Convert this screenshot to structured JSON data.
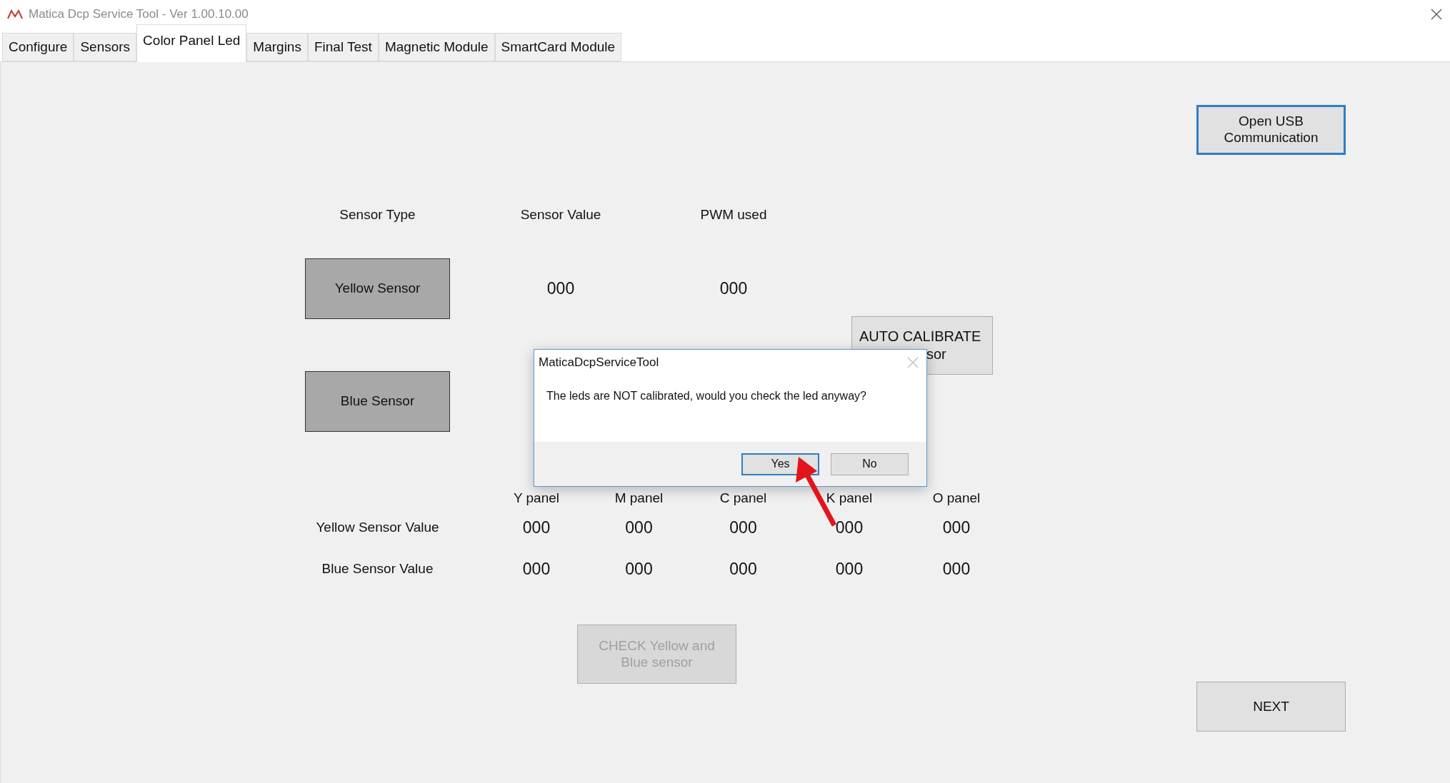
{
  "window": {
    "title": "Matica Dcp Service Tool - Ver 1.00.10.00"
  },
  "tabs": [
    {
      "label": "Configure",
      "selected": false
    },
    {
      "label": "Sensors",
      "selected": false
    },
    {
      "label": "Color Panel Led",
      "selected": true
    },
    {
      "label": "Margins",
      "selected": false
    },
    {
      "label": "Final Test",
      "selected": false
    },
    {
      "label": "Magnetic Module",
      "selected": false
    },
    {
      "label": "SmartCard Module",
      "selected": false
    }
  ],
  "usb_button": {
    "lines": [
      "Open USB",
      "Communication"
    ],
    "focused": true
  },
  "sensor_table": {
    "headers": [
      "Sensor Type",
      "Sensor Value",
      "PWM used"
    ],
    "rows": [
      {
        "sensor": "Yellow Sensor",
        "value": "000",
        "pwm": "000"
      },
      {
        "sensor": "Blue Sensor"
      }
    ]
  },
  "auto_calibrate": {
    "lines": [
      "AUTO CALIBRATE",
      "sor"
    ]
  },
  "panel_table": {
    "columns": [
      "Y panel",
      "M panel",
      "C panel",
      "K panel",
      "O panel"
    ],
    "rows": [
      {
        "label": "Yellow Sensor Value",
        "values": [
          "000",
          "000",
          "000",
          "000",
          "000"
        ]
      },
      {
        "label": "Blue Sensor Value",
        "values": [
          "000",
          "000",
          "000",
          "000",
          "000"
        ]
      }
    ]
  },
  "check_button": {
    "lines": [
      "CHECK Yellow and",
      "Blue sensor"
    ],
    "disabled": true
  },
  "next_button": {
    "label": "NEXT"
  },
  "dialog": {
    "title": "MaticaDcpServiceTool",
    "message": "The leds are NOT calibrated, would you check the led anyway?",
    "buttons": [
      {
        "label": "Yes",
        "selected": true
      },
      {
        "label": "No",
        "selected": false
      }
    ]
  }
}
